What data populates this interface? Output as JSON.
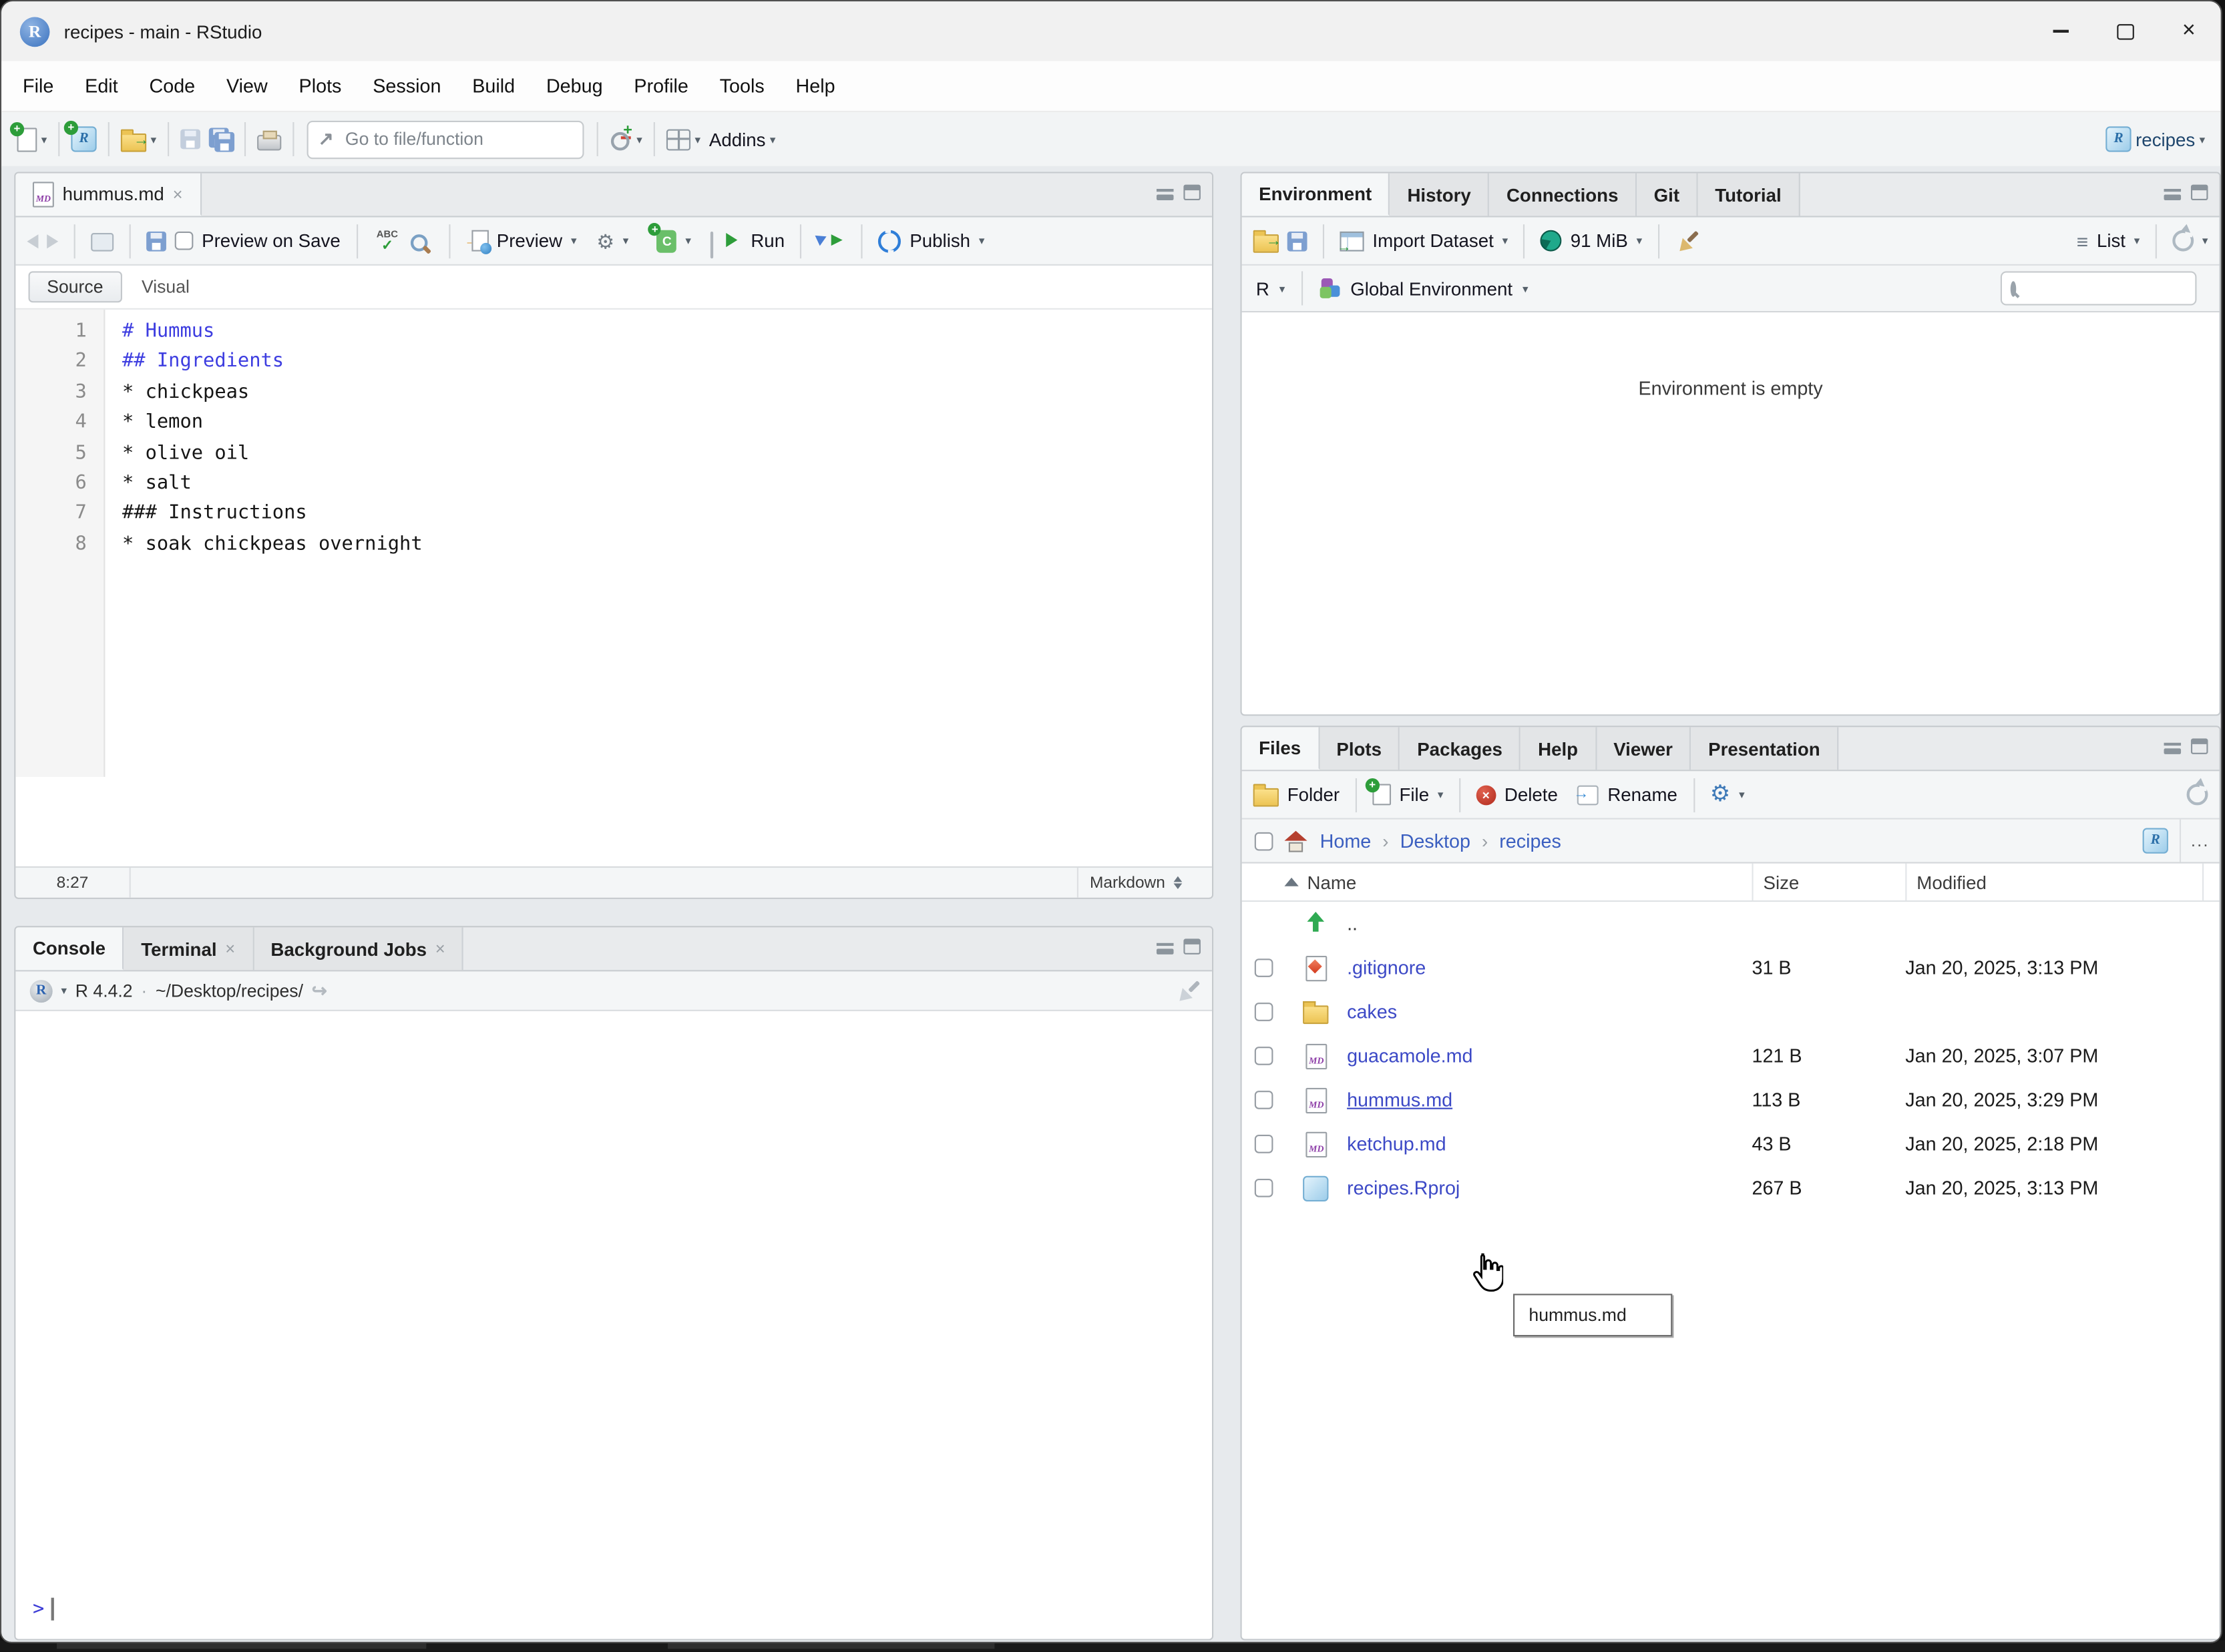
{
  "window": {
    "title": "recipes - main - RStudio"
  },
  "menu": {
    "items": [
      {
        "label": "File"
      },
      {
        "label": "Edit"
      },
      {
        "label": "Code"
      },
      {
        "label": "View"
      },
      {
        "label": "Plots"
      },
      {
        "label": "Session"
      },
      {
        "label": "Build"
      },
      {
        "label": "Debug"
      },
      {
        "label": "Profile"
      },
      {
        "label": "Tools"
      },
      {
        "label": "Help"
      }
    ]
  },
  "toolbar": {
    "goto_placeholder": "Go to file/function",
    "addins_label": "Addins",
    "project_label": "recipes"
  },
  "editor": {
    "tab_label": "hummus.md",
    "toolbar": {
      "preview_on_save": "Preview on Save",
      "abc": "ABC",
      "preview": "Preview",
      "run": "Run",
      "publish": "Publish"
    },
    "mode": {
      "source": "Source",
      "visual": "Visual"
    },
    "lines": [
      {
        "num": "1",
        "text": "# Hummus",
        "cls": "md-heading"
      },
      {
        "num": "2",
        "text": "## Ingredients",
        "cls": "md-heading"
      },
      {
        "num": "3",
        "text": "* chickpeas",
        "cls": ""
      },
      {
        "num": "4",
        "text": "* lemon",
        "cls": ""
      },
      {
        "num": "5",
        "text": "* olive oil",
        "cls": ""
      },
      {
        "num": "6",
        "text": "* salt",
        "cls": ""
      },
      {
        "num": "7",
        "text": "### Instructions",
        "cls": ""
      },
      {
        "num": "8",
        "text": "* soak chickpeas overnight",
        "cls": ""
      }
    ],
    "status": {
      "position": "8:27",
      "mode": "Markdown"
    }
  },
  "environment": {
    "tabs": [
      {
        "label": "Environment",
        "cls": "active"
      },
      {
        "label": "History",
        "cls": ""
      },
      {
        "label": "Connections",
        "cls": ""
      },
      {
        "label": "Git",
        "cls": ""
      },
      {
        "label": "Tutorial",
        "cls": ""
      }
    ],
    "toolbar": {
      "import_dataset": "Import Dataset",
      "memory": "91 MiB",
      "list_label": "List"
    },
    "scope": {
      "lang": "R",
      "env_label": "Global Environment"
    },
    "empty_message": "Environment is empty"
  },
  "files": {
    "tabs": [
      {
        "label": "Files",
        "cls": "active"
      },
      {
        "label": "Plots",
        "cls": ""
      },
      {
        "label": "Packages",
        "cls": ""
      },
      {
        "label": "Help",
        "cls": ""
      },
      {
        "label": "Viewer",
        "cls": ""
      },
      {
        "label": "Presentation",
        "cls": ""
      }
    ],
    "toolbar": {
      "folder": "Folder",
      "file": "File",
      "delete": "Delete",
      "rename": "Rename",
      "ellipsis": "..."
    },
    "breadcrumb": [
      {
        "label": "Home"
      },
      {
        "label": "Desktop"
      },
      {
        "label": "recipes"
      }
    ],
    "columns": {
      "name": "Name",
      "size": "Size",
      "modified": "Modified"
    },
    "rows": [
      {
        "icon": "up",
        "name": "..",
        "size": "",
        "modified": "",
        "cls": "updir"
      },
      {
        "icon": "git",
        "name": ".gitignore",
        "size": "31 B",
        "modified": "Jan 20, 2025, 3:13 PM",
        "cls": ""
      },
      {
        "icon": "folder2",
        "name": "cakes",
        "size": "",
        "modified": "",
        "cls": ""
      },
      {
        "icon": "md",
        "name": "guacamole.md",
        "size": "121 B",
        "modified": "Jan 20, 2025, 3:07 PM",
        "cls": ""
      },
      {
        "icon": "md",
        "name": "hummus.md",
        "size": "113 B",
        "modified": "Jan 20, 2025, 3:29 PM",
        "cls": "hover-row"
      },
      {
        "icon": "md",
        "name": "ketchup.md",
        "size": "43 B",
        "modified": "Jan 20, 2025, 2:18 PM",
        "cls": ""
      },
      {
        "icon": "rproj",
        "name": "recipes.Rproj",
        "size": "267 B",
        "modified": "Jan 20, 2025, 3:13 PM",
        "cls": ""
      }
    ],
    "tooltip": "hummus.md"
  },
  "console": {
    "tabs": [
      {
        "label": "Console",
        "cls": "active"
      },
      {
        "label": "Terminal",
        "cls": "closable"
      },
      {
        "label": "Background Jobs",
        "cls": "closable"
      }
    ],
    "header": {
      "version": "R 4.4.2",
      "dot": "·",
      "path": "~/Desktop/recipes/"
    },
    "prompt": ">"
  },
  "colors": {
    "md_heading": "#3d3de0",
    "file_link": "#3c49c6",
    "breadcrumb_link": "#3b5fc0",
    "prompt_blue": "#3b3bd6"
  }
}
